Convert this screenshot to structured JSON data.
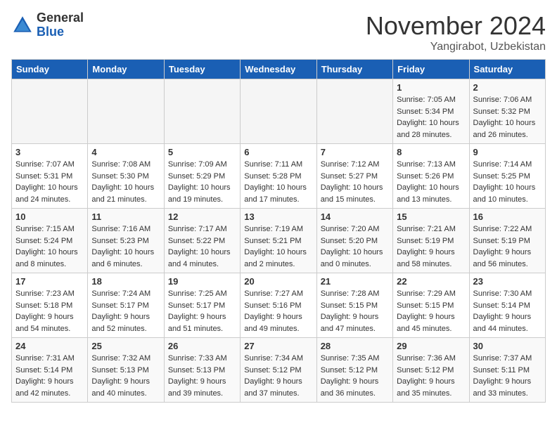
{
  "header": {
    "logo_general": "General",
    "logo_blue": "Blue",
    "month": "November 2024",
    "location": "Yangirabot, Uzbekistan"
  },
  "weekdays": [
    "Sunday",
    "Monday",
    "Tuesday",
    "Wednesday",
    "Thursday",
    "Friday",
    "Saturday"
  ],
  "weeks": [
    [
      {
        "day": "",
        "info": ""
      },
      {
        "day": "",
        "info": ""
      },
      {
        "day": "",
        "info": ""
      },
      {
        "day": "",
        "info": ""
      },
      {
        "day": "",
        "info": ""
      },
      {
        "day": "1",
        "info": "Sunrise: 7:05 AM\nSunset: 5:34 PM\nDaylight: 10 hours\nand 28 minutes."
      },
      {
        "day": "2",
        "info": "Sunrise: 7:06 AM\nSunset: 5:32 PM\nDaylight: 10 hours\nand 26 minutes."
      }
    ],
    [
      {
        "day": "3",
        "info": "Sunrise: 7:07 AM\nSunset: 5:31 PM\nDaylight: 10 hours\nand 24 minutes."
      },
      {
        "day": "4",
        "info": "Sunrise: 7:08 AM\nSunset: 5:30 PM\nDaylight: 10 hours\nand 21 minutes."
      },
      {
        "day": "5",
        "info": "Sunrise: 7:09 AM\nSunset: 5:29 PM\nDaylight: 10 hours\nand 19 minutes."
      },
      {
        "day": "6",
        "info": "Sunrise: 7:11 AM\nSunset: 5:28 PM\nDaylight: 10 hours\nand 17 minutes."
      },
      {
        "day": "7",
        "info": "Sunrise: 7:12 AM\nSunset: 5:27 PM\nDaylight: 10 hours\nand 15 minutes."
      },
      {
        "day": "8",
        "info": "Sunrise: 7:13 AM\nSunset: 5:26 PM\nDaylight: 10 hours\nand 13 minutes."
      },
      {
        "day": "9",
        "info": "Sunrise: 7:14 AM\nSunset: 5:25 PM\nDaylight: 10 hours\nand 10 minutes."
      }
    ],
    [
      {
        "day": "10",
        "info": "Sunrise: 7:15 AM\nSunset: 5:24 PM\nDaylight: 10 hours\nand 8 minutes."
      },
      {
        "day": "11",
        "info": "Sunrise: 7:16 AM\nSunset: 5:23 PM\nDaylight: 10 hours\nand 6 minutes."
      },
      {
        "day": "12",
        "info": "Sunrise: 7:17 AM\nSunset: 5:22 PM\nDaylight: 10 hours\nand 4 minutes."
      },
      {
        "day": "13",
        "info": "Sunrise: 7:19 AM\nSunset: 5:21 PM\nDaylight: 10 hours\nand 2 minutes."
      },
      {
        "day": "14",
        "info": "Sunrise: 7:20 AM\nSunset: 5:20 PM\nDaylight: 10 hours\nand 0 minutes."
      },
      {
        "day": "15",
        "info": "Sunrise: 7:21 AM\nSunset: 5:19 PM\nDaylight: 9 hours\nand 58 minutes."
      },
      {
        "day": "16",
        "info": "Sunrise: 7:22 AM\nSunset: 5:19 PM\nDaylight: 9 hours\nand 56 minutes."
      }
    ],
    [
      {
        "day": "17",
        "info": "Sunrise: 7:23 AM\nSunset: 5:18 PM\nDaylight: 9 hours\nand 54 minutes."
      },
      {
        "day": "18",
        "info": "Sunrise: 7:24 AM\nSunset: 5:17 PM\nDaylight: 9 hours\nand 52 minutes."
      },
      {
        "day": "19",
        "info": "Sunrise: 7:25 AM\nSunset: 5:17 PM\nDaylight: 9 hours\nand 51 minutes."
      },
      {
        "day": "20",
        "info": "Sunrise: 7:27 AM\nSunset: 5:16 PM\nDaylight: 9 hours\nand 49 minutes."
      },
      {
        "day": "21",
        "info": "Sunrise: 7:28 AM\nSunset: 5:15 PM\nDaylight: 9 hours\nand 47 minutes."
      },
      {
        "day": "22",
        "info": "Sunrise: 7:29 AM\nSunset: 5:15 PM\nDaylight: 9 hours\nand 45 minutes."
      },
      {
        "day": "23",
        "info": "Sunrise: 7:30 AM\nSunset: 5:14 PM\nDaylight: 9 hours\nand 44 minutes."
      }
    ],
    [
      {
        "day": "24",
        "info": "Sunrise: 7:31 AM\nSunset: 5:14 PM\nDaylight: 9 hours\nand 42 minutes."
      },
      {
        "day": "25",
        "info": "Sunrise: 7:32 AM\nSunset: 5:13 PM\nDaylight: 9 hours\nand 40 minutes."
      },
      {
        "day": "26",
        "info": "Sunrise: 7:33 AM\nSunset: 5:13 PM\nDaylight: 9 hours\nand 39 minutes."
      },
      {
        "day": "27",
        "info": "Sunrise: 7:34 AM\nSunset: 5:12 PM\nDaylight: 9 hours\nand 37 minutes."
      },
      {
        "day": "28",
        "info": "Sunrise: 7:35 AM\nSunset: 5:12 PM\nDaylight: 9 hours\nand 36 minutes."
      },
      {
        "day": "29",
        "info": "Sunrise: 7:36 AM\nSunset: 5:12 PM\nDaylight: 9 hours\nand 35 minutes."
      },
      {
        "day": "30",
        "info": "Sunrise: 7:37 AM\nSunset: 5:11 PM\nDaylight: 9 hours\nand 33 minutes."
      }
    ]
  ]
}
